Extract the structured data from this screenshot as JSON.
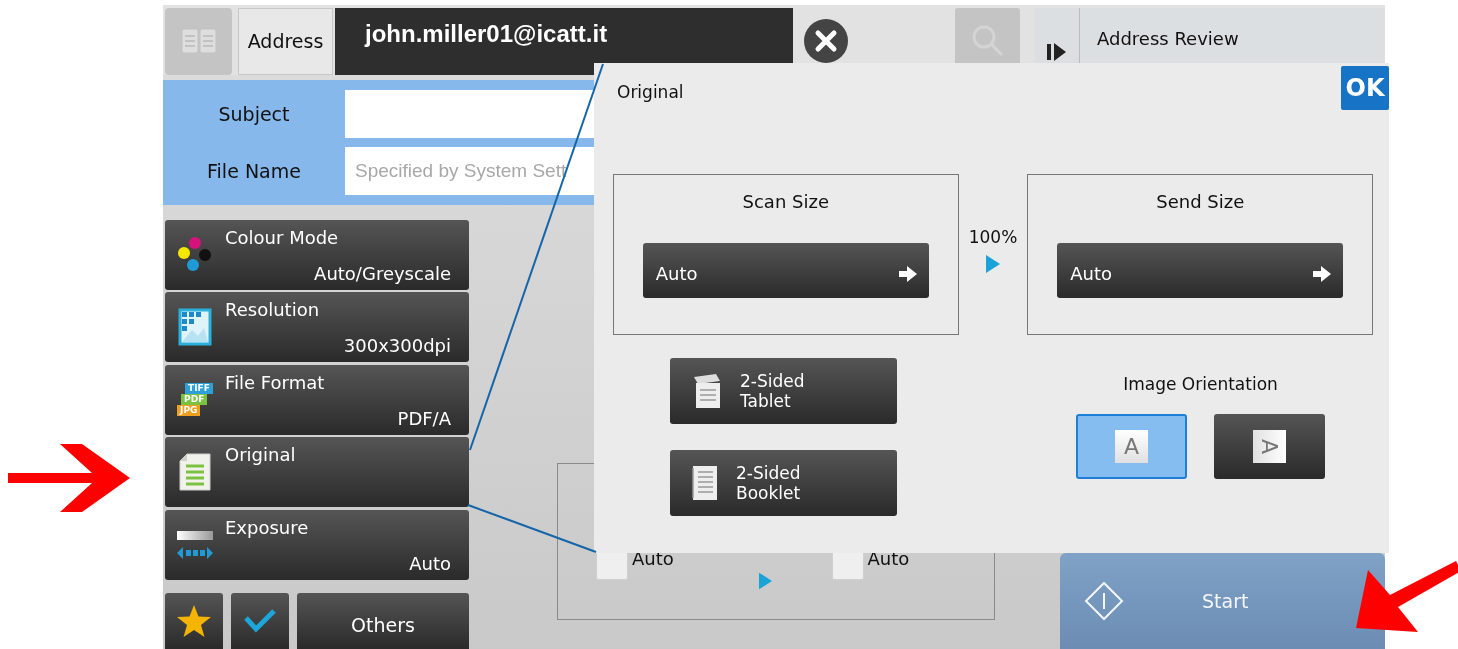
{
  "top_bar": {
    "address_tab": "Address",
    "address_value": "john.miller01@icatt.it",
    "address_review": "Address Review"
  },
  "fields": [
    {
      "kind": "text",
      "label": "Subject"
    },
    {
      "kind": "text",
      "label": "File Name",
      "placeholder": "Specified by System Sett"
    }
  ],
  "settings": [
    {
      "kind": "colour",
      "label": "Colour Mode",
      "value": "Auto/Greyscale"
    },
    {
      "kind": "resolution",
      "label": "Resolution",
      "value": "300x300dpi"
    },
    {
      "kind": "format",
      "label": "File Format",
      "value": "PDF/A",
      "tags": [
        "TIFF",
        "PDF",
        "JPG"
      ]
    },
    {
      "kind": "original",
      "label": "Original"
    },
    {
      "kind": "exposure",
      "label": "Exposure",
      "value": "Auto"
    }
  ],
  "others": "Others",
  "preview": [
    {
      "value": "Auto",
      "checked": false
    },
    {
      "value": "Auto",
      "checked": false
    }
  ],
  "start": {
    "label": "Start",
    "disabled": true
  },
  "dialog": {
    "title": "Original",
    "ok": "OK",
    "scan_size": {
      "title": "Scan Size",
      "value": "Auto"
    },
    "ratio": "100%",
    "send_size": {
      "title": "Send Size",
      "value": "Auto"
    },
    "original_types": [
      {
        "kind": "tablet",
        "label": "2-Sided Tablet"
      },
      {
        "kind": "booklet",
        "label": "2-Sided Booklet"
      }
    ],
    "orientation": {
      "title": "Image Orientation",
      "options": [
        {
          "kind": "portrait",
          "glyph": "A",
          "selected": true
        },
        {
          "kind": "landscape",
          "glyph": "A",
          "selected": false
        }
      ]
    }
  }
}
